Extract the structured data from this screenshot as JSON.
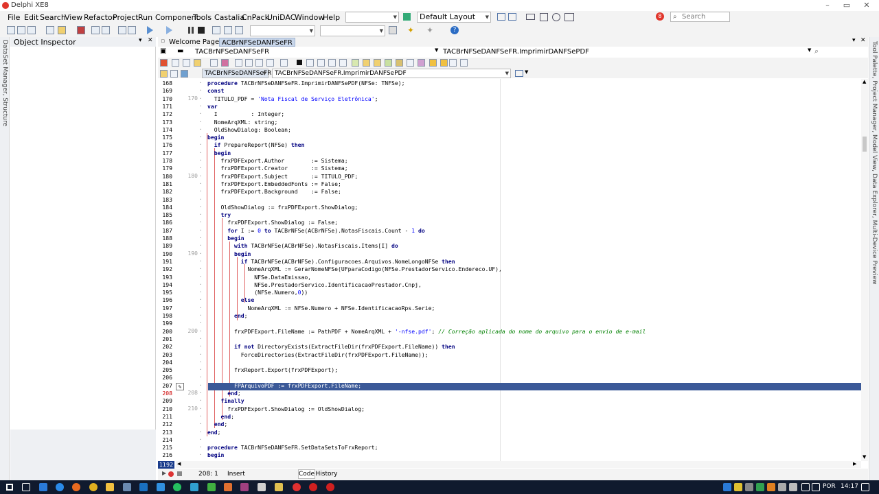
{
  "window": {
    "title": "Delphi XE8"
  },
  "menu": [
    "File",
    "Edit",
    "Search",
    "View",
    "Refactor",
    "Project",
    "Run",
    "Component",
    "Tools",
    "Castalia",
    "CnPack",
    "UniDAC",
    "Window",
    "Help"
  ],
  "toolbar": {
    "layout_value": "Default Layout",
    "search_placeholder": "Search",
    "alert_count": "8"
  },
  "object_inspector": {
    "title": "Object Inspector",
    "left_vertical_label": "DataSet Manager, Structure"
  },
  "tabs": [
    {
      "label": "Welcome Page",
      "active": false
    },
    {
      "label": "ACBrNFSeDANFSeFR",
      "active": true
    }
  ],
  "nav": {
    "unit": "TACBrNFSeDANFSeFR",
    "method": "TACBrNFSeDANFSeFR.ImprimirDANFSePDF"
  },
  "proc_bar": {
    "class": "TACBrNFSeDANFSeFR",
    "method": "TACBrNFSeDANFSeFR.ImprimirDANFSePDF"
  },
  "editor": {
    "lines": [
      {
        "n": "168",
        "g": "",
        "t": "procedure TACBrNFSeDANFSeFR.ImprimirDANFSePDF(NFSe: TNFSe);"
      },
      {
        "n": "169",
        "g": "",
        "t": "const"
      },
      {
        "n": "170",
        "g": "170",
        "t": "  TITULO_PDF = 'Nota Fiscal de Serviço Eletrônica';"
      },
      {
        "n": "171",
        "g": "",
        "t": "var"
      },
      {
        "n": "172",
        "g": "",
        "t": "  I          : Integer;"
      },
      {
        "n": "173",
        "g": "",
        "t": "  NomeArqXML: string;"
      },
      {
        "n": "174",
        "g": "",
        "t": "  OldShowDialog: Boolean;"
      },
      {
        "n": "175",
        "g": "",
        "t": "begin"
      },
      {
        "n": "176",
        "g": "",
        "t": "  if PrepareReport(NFSe) then"
      },
      {
        "n": "177",
        "g": "",
        "t": "  begin"
      },
      {
        "n": "178",
        "g": "",
        "t": "    frxPDFExport.Author        := Sistema;"
      },
      {
        "n": "179",
        "g": "",
        "t": "    frxPDFExport.Creator       := Sistema;"
      },
      {
        "n": "180",
        "g": "180",
        "t": "    frxPDFExport.Subject       := TITULO_PDF;"
      },
      {
        "n": "181",
        "g": "",
        "t": "    frxPDFExport.EmbeddedFonts := False;"
      },
      {
        "n": "182",
        "g": "",
        "t": "    frxPDFExport.Background    := False;"
      },
      {
        "n": "183",
        "g": "",
        "t": ""
      },
      {
        "n": "184",
        "g": "",
        "t": "    OldShowDialog := frxPDFExport.ShowDialog;"
      },
      {
        "n": "185",
        "g": "",
        "t": "    try"
      },
      {
        "n": "186",
        "g": "",
        "t": "      frxPDFExport.ShowDialog := False;"
      },
      {
        "n": "187",
        "g": "",
        "t": "      for I := 0 to TACBrNFSe(ACBrNFSe).NotasFiscais.Count - 1 do"
      },
      {
        "n": "188",
        "g": "",
        "t": "      begin"
      },
      {
        "n": "189",
        "g": "",
        "t": "        with TACBrNFSe(ACBrNFSe).NotasFiscais.Items[I] do"
      },
      {
        "n": "190",
        "g": "190",
        "t": "        begin"
      },
      {
        "n": "191",
        "g": "",
        "t": "          if TACBrNFSe(ACBrNFSe).Configuracoes.Arquivos.NomeLongoNFSe then"
      },
      {
        "n": "192",
        "g": "",
        "t": "            NomeArqXML := GerarNomeNFSe(UFparaCodigo(NFSe.PrestadorServico.Endereco.UF),"
      },
      {
        "n": "193",
        "g": "",
        "t": "              NFSe.DataEmissao,"
      },
      {
        "n": "194",
        "g": "",
        "t": "              NFSe.PrestadorServico.IdentificacaoPrestador.Cnpj,"
      },
      {
        "n": "195",
        "g": "",
        "t": "              StrToInt64Def(NFSe.Numero,0))"
      },
      {
        "n": "196",
        "g": "",
        "t": "          else"
      },
      {
        "n": "197",
        "g": "",
        "t": "            NomeArqXML := NFSe.Numero + NFSe.IdentificacaoRps.Serie;"
      },
      {
        "n": "198",
        "g": "",
        "t": "        end;"
      },
      {
        "n": "199",
        "g": "",
        "t": ""
      },
      {
        "n": "200",
        "g": "200",
        "t": "        frxPDFExport.FileName := PathPDF + NomeArqXML + '-nfse.pdf'; // Correção aplicada do nome do arquivo para o envio de e-mail"
      },
      {
        "n": "201",
        "g": "",
        "t": ""
      },
      {
        "n": "202",
        "g": "",
        "t": "        if not DirectoryExists(ExtractFileDir(frxPDFExport.FileName)) then"
      },
      {
        "n": "203",
        "g": "",
        "t": "          ForceDirectories(ExtractFileDir(frxPDFExport.FileName));"
      },
      {
        "n": "204",
        "g": "",
        "t": ""
      },
      {
        "n": "205",
        "g": "",
        "t": "        frxReport.Export(frxPDFExport);"
      },
      {
        "n": "206",
        "g": "",
        "t": ""
      },
      {
        "n": "207",
        "g": "",
        "t": "        FPArquivoPDF := frxPDFExport.FileName;"
      },
      {
        "n": "208",
        "g": "208",
        "t": "      end;"
      },
      {
        "n": "209",
        "g": "",
        "t": "    finally"
      },
      {
        "n": "210",
        "g": "210",
        "t": "      frxPDFExport.ShowDialog := OldShowDialog;"
      },
      {
        "n": "211",
        "g": "",
        "t": "    end;"
      },
      {
        "n": "212",
        "g": "",
        "t": "  end;"
      },
      {
        "n": "213",
        "g": "",
        "t": "end;"
      },
      {
        "n": "214",
        "g": "",
        "t": ""
      },
      {
        "n": "215",
        "g": "",
        "t": "procedure TACBrNFSeDANFSeFR.SetDataSetsToFrxReport;"
      },
      {
        "n": "216",
        "g": "",
        "t": "begin"
      }
    ],
    "highlight_line": "207",
    "line_count_badge": "1192"
  },
  "status": {
    "position": "208: 1",
    "mode": "Insert",
    "tab_code": "Code",
    "tab_history": "History"
  },
  "right_vertical_label": "Tool Palette, Project Manager, Model View, Data Explorer, Multi-Device Preview",
  "taskbar": {
    "language": "POR",
    "time": "14:17"
  },
  "colors": {
    "highlight": "#3b5998",
    "keyword": "#000080",
    "string": "#0000ff",
    "comment": "#008000"
  }
}
